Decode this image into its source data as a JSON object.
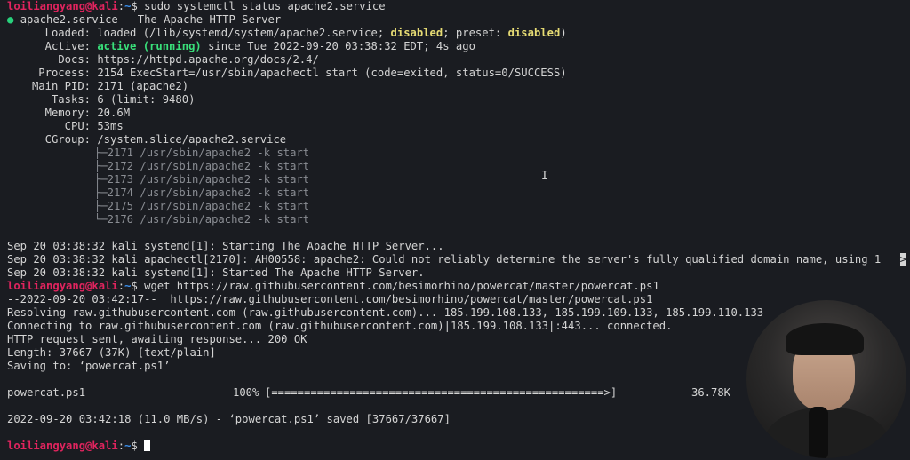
{
  "prompt": {
    "user": "loiliangyang@kali",
    "sep": ":",
    "path": "~",
    "symbol": "$"
  },
  "commands": {
    "status": "sudo systemctl status apache2.service",
    "wget": "wget https://raw.githubusercontent.com/besimorhino/powercat/master/powercat.ps1"
  },
  "service": {
    "bullet": "●",
    "header": "apache2.service - The Apache HTTP Server",
    "loaded_label": "Loaded:",
    "loaded_pre": "loaded (/lib/systemd/system/apache2.service; ",
    "loaded_disabled": "disabled",
    "loaded_mid": "; preset: ",
    "loaded_preset": "disabled",
    "loaded_end": ")",
    "active_label": "Active:",
    "active_state": "active (running)",
    "active_rest": " since Tue 2022-09-20 03:38:32 EDT; 4s ago",
    "docs_label": "Docs:",
    "docs": "https://httpd.apache.org/docs/2.4/",
    "process_label": "Process:",
    "process": "2154 ExecStart=/usr/sbin/apachectl start (code=exited, status=0/SUCCESS)",
    "mainpid_label": "Main PID:",
    "mainpid": "2171 (apache2)",
    "tasks_label": "Tasks:",
    "tasks": "6 (limit: 9480)",
    "memory_label": "Memory:",
    "memory": "20.6M",
    "cpu_label": "CPU:",
    "cpu": "53ms",
    "cgroup_label": "CGroup:",
    "cgroup": "/system.slice/apache2.service",
    "processes": [
      "├─2171 /usr/sbin/apache2 -k start",
      "├─2172 /usr/sbin/apache2 -k start",
      "├─2173 /usr/sbin/apache2 -k start",
      "├─2174 /usr/sbin/apache2 -k start",
      "├─2175 /usr/sbin/apache2 -k start",
      "└─2176 /usr/sbin/apache2 -k start"
    ]
  },
  "logs": [
    "Sep 20 03:38:32 kali systemd[1]: Starting The Apache HTTP Server...",
    "Sep 20 03:38:32 kali apachectl[2170]: AH00558: apache2: Could not reliably determine the server's fully qualified domain name, using 1",
    "Sep 20 03:38:32 kali systemd[1]: Started The Apache HTTP Server."
  ],
  "log_overflow_marker": ">",
  "wget_output": [
    "--2022-09-20 03:42:17--  https://raw.githubusercontent.com/besimorhino/powercat/master/powercat.ps1",
    "Resolving raw.githubusercontent.com (raw.githubusercontent.com)... 185.199.108.133, 185.199.109.133, 185.199.110.133",
    "Connecting to raw.githubusercontent.com (raw.githubusercontent.com)|185.199.108.133|:443... connected.",
    "HTTP request sent, awaiting response... 200 OK",
    "Length: 37667 (37K) [text/plain]",
    "Saving to: ‘powercat.ps1’"
  ],
  "progress": {
    "filename": "powercat.ps1",
    "percent": "100%",
    "bar": "[===================================================>]",
    "speed": "36.78K",
    "fraction": 1.0
  },
  "saved_line": "2022-09-20 03:42:18 (11.0 MB/s) - ‘powercat.ps1’ saved [37667/37667]",
  "ibeam": "I",
  "colors": {
    "background": "#1a1c21",
    "prompt_user": "#e0245e",
    "prompt_path": "#3b8eea",
    "active": "#39e07a",
    "disabled": "#e6db74"
  }
}
